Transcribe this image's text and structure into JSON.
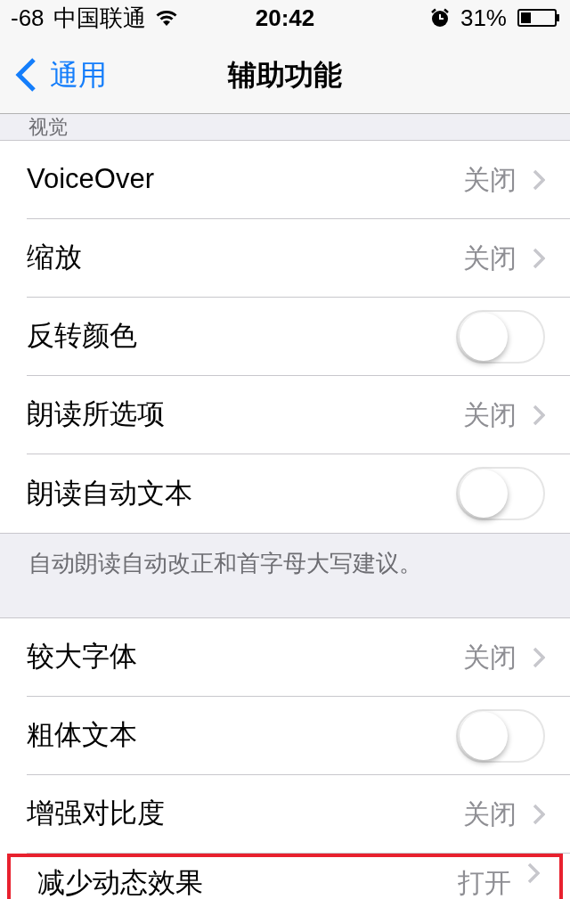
{
  "status_bar": {
    "signal": "-68",
    "carrier": "中国联通",
    "time": "20:42",
    "battery": "31%"
  },
  "nav": {
    "back": "通用",
    "title": "辅助功能"
  },
  "section_header": "视觉",
  "groups": [
    {
      "rows": [
        {
          "kind": "disclosure",
          "label": "VoiceOver",
          "value": "关闭",
          "highlighted": false
        },
        {
          "kind": "disclosure",
          "label": "缩放",
          "value": "关闭",
          "highlighted": false
        },
        {
          "kind": "toggle",
          "label": "反转颜色",
          "on": false,
          "highlighted": false
        },
        {
          "kind": "disclosure",
          "label": "朗读所选项",
          "value": "关闭",
          "highlighted": false
        },
        {
          "kind": "toggle",
          "label": "朗读自动文本",
          "on": false,
          "highlighted": false
        }
      ],
      "footer": "自动朗读自动改正和首字母大写建议。"
    },
    {
      "rows": [
        {
          "kind": "disclosure",
          "label": "较大字体",
          "value": "关闭",
          "highlighted": false
        },
        {
          "kind": "toggle",
          "label": "粗体文本",
          "on": false,
          "highlighted": false
        },
        {
          "kind": "disclosure",
          "label": "增强对比度",
          "value": "关闭",
          "highlighted": false
        },
        {
          "kind": "disclosure",
          "label": "减少动态效果",
          "value": "打开",
          "highlighted": true
        }
      ]
    }
  ]
}
